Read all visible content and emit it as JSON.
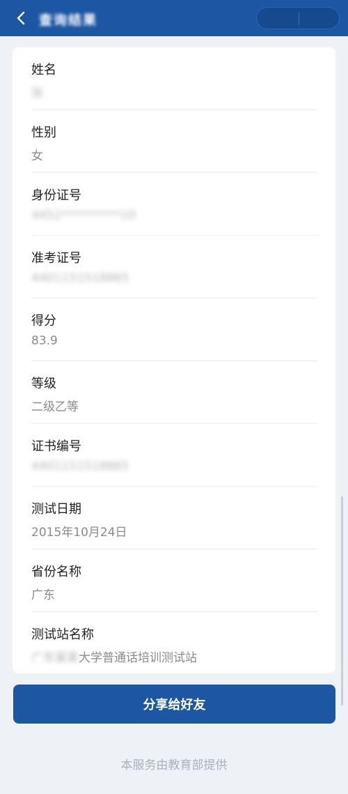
{
  "header": {
    "title": "查询结果",
    "back_icon": "chevron-left-icon"
  },
  "fields": [
    {
      "label": "姓名",
      "value": "张",
      "blurred": true
    },
    {
      "label": "性别",
      "value": "女",
      "blurred": false
    },
    {
      "label": "身份证号",
      "value": "4452**********20",
      "blurred": true
    },
    {
      "label": "准考证号",
      "value": "4401151518865",
      "blurred": true
    },
    {
      "label": "得分",
      "value": "83.9",
      "blurred": false
    },
    {
      "label": "等级",
      "value": "二级乙等",
      "blurred": false
    },
    {
      "label": "证书编号",
      "value": "4401151518865",
      "blurred": true
    },
    {
      "label": "测试日期",
      "value": "2015年10月24日",
      "blurred": false
    },
    {
      "label": "省份名称",
      "value": "广东",
      "blurred": false
    },
    {
      "label": "测试站名称",
      "value_blurred": "广东某某",
      "value": "大学普通话培训测试站",
      "blurred": false
    }
  ],
  "share_button": {
    "label": "分享给好友"
  },
  "footer": {
    "text": "本服务由教育部提供"
  },
  "colors": {
    "primary": "#1d57a3",
    "background": "#eef1f6"
  }
}
